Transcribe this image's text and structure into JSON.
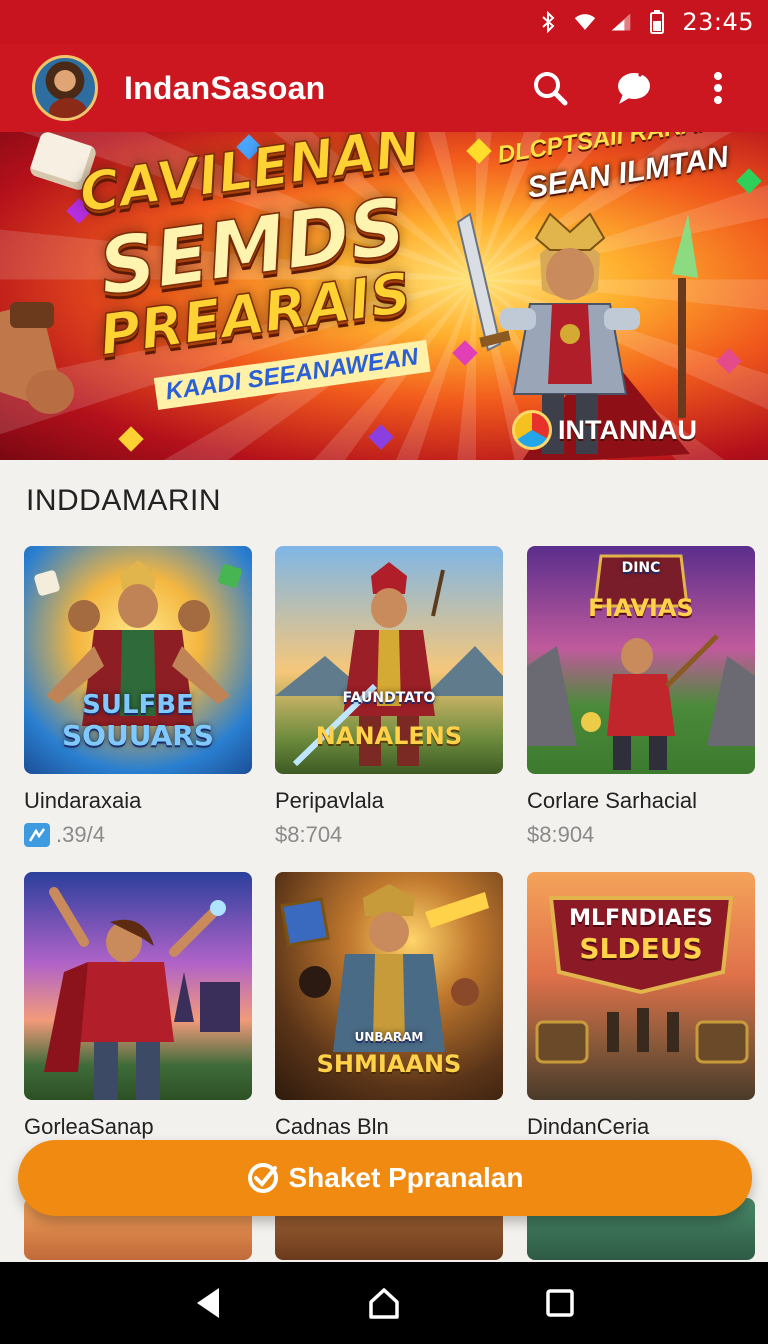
{
  "status_bar": {
    "time": "23:45",
    "icons": [
      "bluetooth-icon",
      "wifi-icon",
      "signal-icon",
      "battery-icon"
    ]
  },
  "app_bar": {
    "title": "IndanSasoan",
    "actions": [
      "search-icon",
      "chat-icon",
      "more-vert-icon"
    ]
  },
  "banner": {
    "title_line1": "CAVILENAN",
    "title_line2": "SEMDS",
    "title_line3": "PREARAIS",
    "tagline": "KAADI SEEANAWEAN",
    "subtitle_line1": "DLCPTSAII RARAAUIAK",
    "subtitle_line2": "SEAN ILMTAN",
    "badge": "INTANNAU"
  },
  "section": {
    "title": "INDDAMARIN"
  },
  "games": [
    {
      "thumb_label_1": "SULFBE",
      "thumb_label_2": "SOUUARS",
      "name": "Uindaraxaia",
      "price": ".39/4",
      "price_icon": "app-badge-icon"
    },
    {
      "thumb_label_1": "FAUNDTATO",
      "thumb_label_2": "NANALENS",
      "name": "Peripavlala",
      "price": "$8:704",
      "price_icon": ""
    },
    {
      "thumb_label_1": "DINC",
      "thumb_label_2": "FIAVIAS",
      "name": "Corlare Sarhacial",
      "price": "$8:904",
      "price_icon": ""
    },
    {
      "thumb_label_1": "",
      "thumb_label_2": "",
      "name": "GorleaSanap",
      "price": "",
      "price_icon": ""
    },
    {
      "thumb_label_1": "UNBARAM",
      "thumb_label_2": "SHMIAANS",
      "name": "Cadnas Bln",
      "price": "",
      "price_icon": ""
    },
    {
      "thumb_label_1": "MLFNDIAES",
      "thumb_label_2": "SLDEUS",
      "name": "DindanCeria",
      "price": "",
      "price_icon": ""
    }
  ],
  "cta": {
    "label": "Shaket Ppranalan",
    "icon": "check-circle-icon"
  },
  "nav_bar": {
    "buttons": [
      "back-icon",
      "home-icon",
      "recents-icon"
    ]
  },
  "colors": {
    "brand_red": "#cc1620",
    "cta_orange": "#f08a10",
    "background": "#f3f1ee"
  }
}
